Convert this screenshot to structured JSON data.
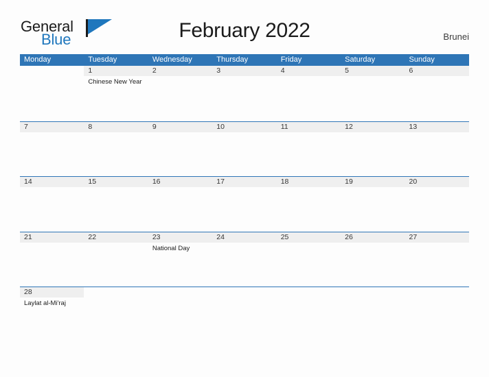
{
  "brand": {
    "name_part1": "General",
    "name_part2": "Blue",
    "flag_icon": "flag-triangle-icon"
  },
  "header": {
    "title": "February 2022",
    "region": "Brunei"
  },
  "colors": {
    "header_blue": "#2e75b6",
    "row_separator_blue": "#2e75b6",
    "date_band_gray": "#efefef",
    "brand_blue": "#1f77bd",
    "page_background": "#fdfdfd",
    "text_dark": "#1b1b1b"
  },
  "calendar": {
    "weekdays": [
      "Monday",
      "Tuesday",
      "Wednesday",
      "Thursday",
      "Friday",
      "Saturday",
      "Sunday"
    ],
    "weeks": [
      [
        {
          "date": "",
          "events": []
        },
        {
          "date": "1",
          "events": [
            "Chinese New Year"
          ]
        },
        {
          "date": "2",
          "events": []
        },
        {
          "date": "3",
          "events": []
        },
        {
          "date": "4",
          "events": []
        },
        {
          "date": "5",
          "events": []
        },
        {
          "date": "6",
          "events": []
        }
      ],
      [
        {
          "date": "7",
          "events": []
        },
        {
          "date": "8",
          "events": []
        },
        {
          "date": "9",
          "events": []
        },
        {
          "date": "10",
          "events": []
        },
        {
          "date": "11",
          "events": []
        },
        {
          "date": "12",
          "events": []
        },
        {
          "date": "13",
          "events": []
        }
      ],
      [
        {
          "date": "14",
          "events": []
        },
        {
          "date": "15",
          "events": []
        },
        {
          "date": "16",
          "events": []
        },
        {
          "date": "17",
          "events": []
        },
        {
          "date": "18",
          "events": []
        },
        {
          "date": "19",
          "events": []
        },
        {
          "date": "20",
          "events": []
        }
      ],
      [
        {
          "date": "21",
          "events": []
        },
        {
          "date": "22",
          "events": []
        },
        {
          "date": "23",
          "events": [
            "National Day"
          ]
        },
        {
          "date": "24",
          "events": []
        },
        {
          "date": "25",
          "events": []
        },
        {
          "date": "26",
          "events": []
        },
        {
          "date": "27",
          "events": []
        }
      ],
      [
        {
          "date": "28",
          "events": [
            "Laylat al-Mi'raj"
          ]
        },
        {
          "date": "",
          "events": []
        },
        {
          "date": "",
          "events": []
        },
        {
          "date": "",
          "events": []
        },
        {
          "date": "",
          "events": []
        },
        {
          "date": "",
          "events": []
        },
        {
          "date": "",
          "events": []
        }
      ]
    ]
  }
}
